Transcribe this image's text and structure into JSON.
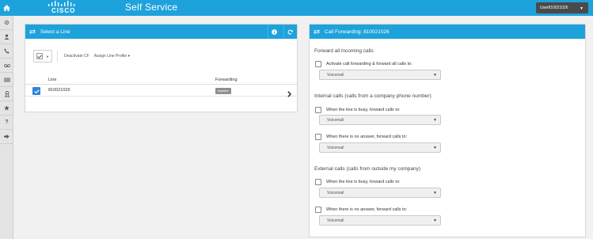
{
  "header": {
    "logo_text": "CISCO",
    "app_title": "Self Service",
    "user_label": "User810021026"
  },
  "sidebar": {
    "items": [
      {
        "icon": "gear-icon"
      },
      {
        "icon": "user-icon"
      },
      {
        "icon": "phone-icon"
      },
      {
        "icon": "voicemail-icon"
      },
      {
        "icon": "list-icon"
      },
      {
        "icon": "badge-icon"
      },
      {
        "icon": "star-icon"
      },
      {
        "icon": "help-icon"
      },
      {
        "icon": "sign-out-icon"
      }
    ]
  },
  "left_panel": {
    "title": "Select a Line",
    "toolbar": {
      "deactivate_cf": "Deactivate CF",
      "assign_line_profile": "Assign Line Profile ▾"
    },
    "columns": [
      "Line",
      "Forwarding"
    ],
    "rows": [
      {
        "line": "810021026",
        "forwarding": "Inactive",
        "selected": true
      }
    ]
  },
  "right_panel": {
    "title": "Call Forwarding: 810021026",
    "sections": [
      {
        "heading": "Forward all incoming calls",
        "options": [
          {
            "label": "Activate call forwarding & forward all calls to:",
            "value": "Voicemail"
          }
        ]
      },
      {
        "heading": "Internal calls (calls from a company phone number)",
        "options": [
          {
            "label": "When the line is busy, forward calls to:",
            "value": "Voicemail"
          },
          {
            "label": "When there is no answer, forward calls to:",
            "value": "Voicemail"
          }
        ]
      },
      {
        "heading": "External calls (calls from outside my company)",
        "options": [
          {
            "label": "When the line is busy, forward calls to:",
            "value": "Voicemail"
          },
          {
            "label": "When there is no answer, forward calls to:",
            "value": "Voicemail"
          }
        ]
      }
    ]
  },
  "colors": {
    "brand_blue": "#1ea2db",
    "selected_blue": "#2f86d6",
    "user_menu_bg": "#4a4a4a",
    "badge_gray": "#8f8f8f"
  }
}
